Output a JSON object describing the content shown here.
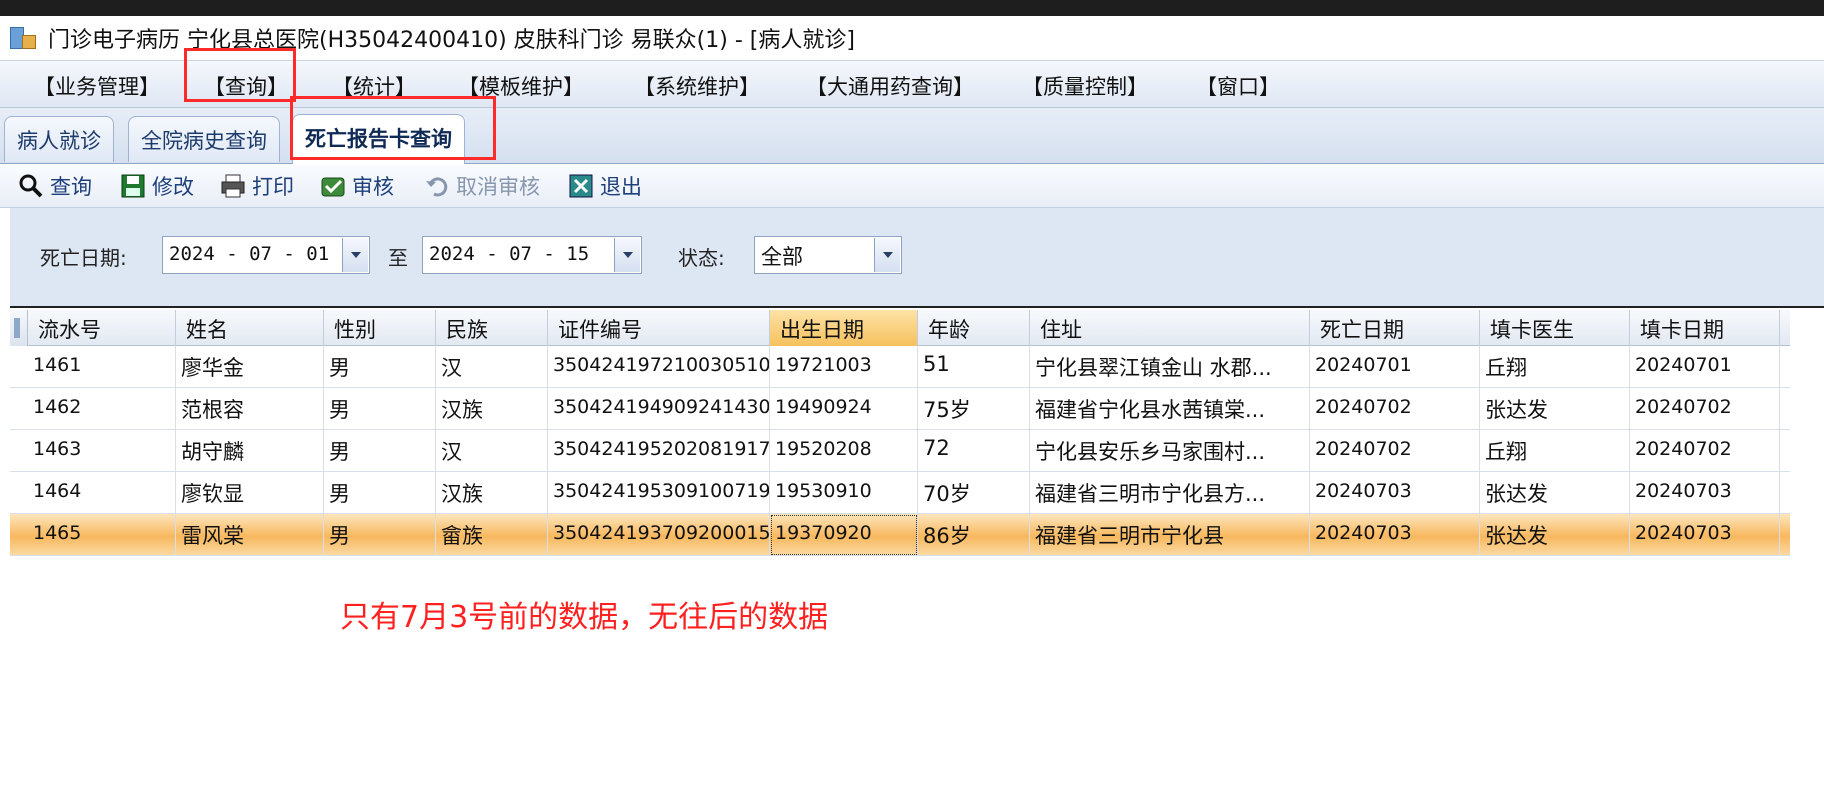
{
  "window": {
    "title": "门诊电子病历  宁化县总医院(H35042400410)  皮肤科门诊  易联众(1) - [病人就诊]",
    "icon": "app-icon"
  },
  "menu": [
    "【业务管理】",
    "【查询】",
    "【统计】",
    "【模板维护】",
    "【系统维护】",
    "【大通用药查询】",
    "【质量控制】",
    "【窗口】"
  ],
  "tabs": [
    "病人就诊",
    "全院病史查询",
    "死亡报告卡查询"
  ],
  "active_tab": "死亡报告卡查询",
  "toolbar": [
    {
      "label": "查询",
      "icon": "search-icon",
      "enabled": true
    },
    {
      "label": "修改",
      "icon": "save-icon",
      "enabled": true
    },
    {
      "label": "打印",
      "icon": "printer-icon",
      "enabled": true
    },
    {
      "label": "审核",
      "icon": "approve-icon",
      "enabled": true
    },
    {
      "label": "取消审核",
      "icon": "undo-icon",
      "enabled": false
    },
    {
      "label": "退出",
      "icon": "exit-icon",
      "enabled": true
    }
  ],
  "filter": {
    "death_date_label": "死亡日期:",
    "date_from": "2024 - 07 - 01",
    "to_label": "至",
    "date_to": "2024 - 07 - 15",
    "status_label": "状态:",
    "status_value": "全部"
  },
  "table": {
    "columns": [
      "流水号",
      "姓名",
      "性别",
      "民族",
      "证件编号",
      "出生日期",
      "年龄",
      "住址",
      "死亡日期",
      "填卡医生",
      "填卡日期"
    ],
    "sorted_column": "出生日期",
    "rows": [
      [
        "1461",
        "廖华金",
        "男",
        "汉",
        "350424197210030510",
        "19721003",
        "51",
        "宁化县翠江镇金山 水郡...",
        "20240701",
        "丘翔",
        "20240701"
      ],
      [
        "1462",
        "范根容",
        "男",
        "汉族",
        "350424194909241430",
        "19490924",
        "75岁",
        "福建省宁化县水茜镇棠...",
        "20240702",
        "张达发",
        "20240702"
      ],
      [
        "1463",
        "胡守麟",
        "男",
        "汉",
        "350424195202081917",
        "19520208",
        "72",
        "宁化县安乐乡马家围村...",
        "20240702",
        "丘翔",
        "20240702"
      ],
      [
        "1464",
        "廖钦显",
        "男",
        "汉族",
        "350424195309100719",
        "19530910",
        "70岁",
        "福建省三明市宁化县方...",
        "20240703",
        "张达发",
        "20240703"
      ],
      [
        "1465",
        "雷风棠",
        "男",
        "畲族",
        "350424193709200015",
        "19370920",
        "86岁",
        "福建省三明市宁化县",
        "20240703",
        "张达发",
        "20240703"
      ]
    ],
    "selected_row": 4
  },
  "annotation": {
    "note": "只有7月3号前的数据，无往后的数据",
    "color": "#ff2020"
  }
}
